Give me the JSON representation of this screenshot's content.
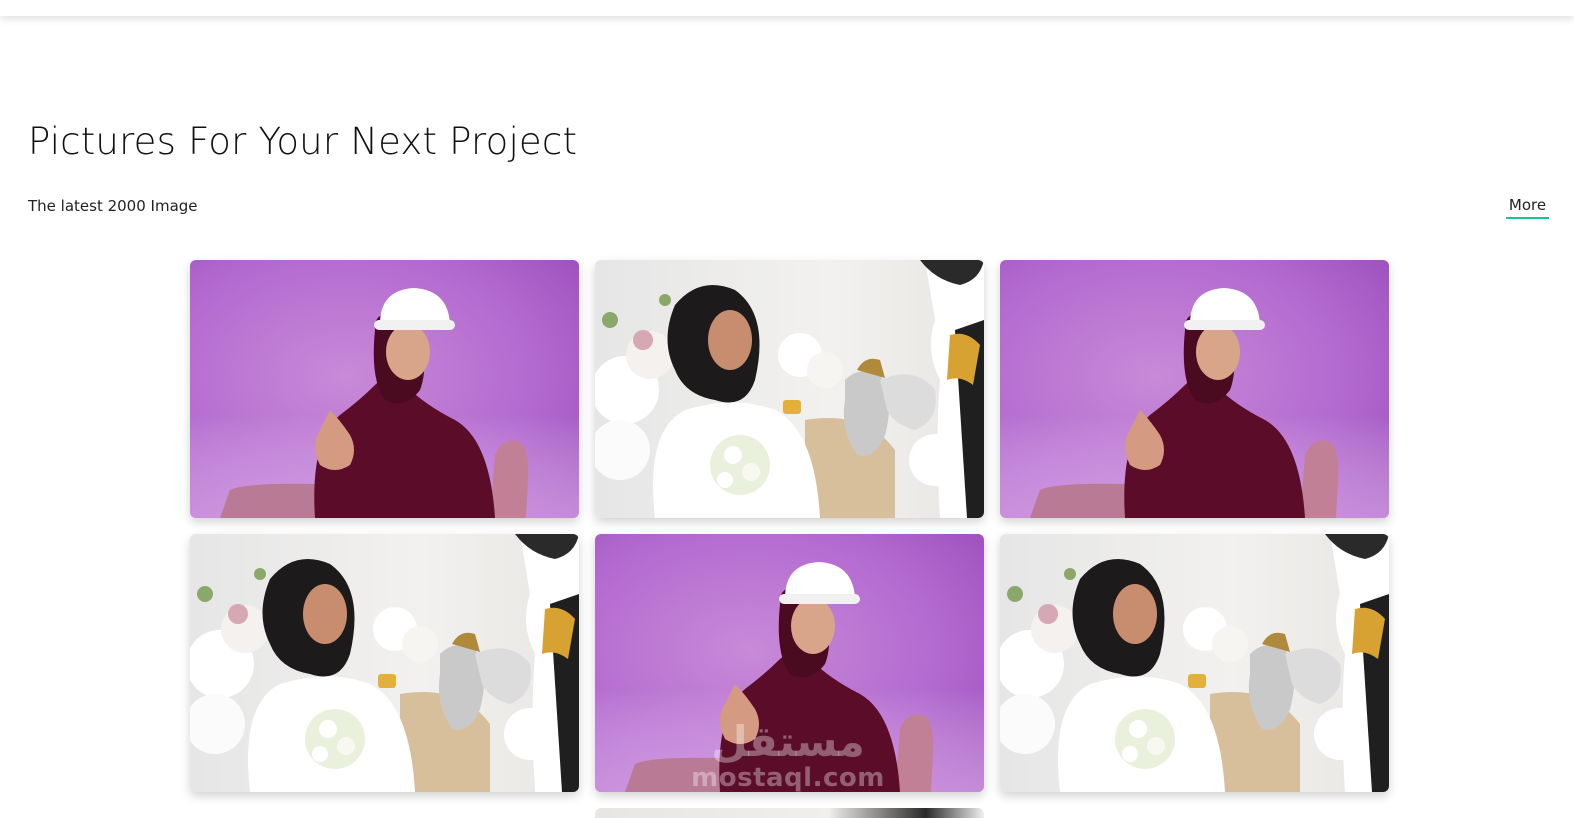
{
  "header": {
    "title": "Pictures For Your Next Project",
    "subtitle": "The latest 2000 Image",
    "more_label": "More"
  },
  "colors": {
    "accent_underline": "#1cc38e",
    "purple_bg": "#b36ad0",
    "hijab": "#5a0c28"
  },
  "gallery": {
    "items": [
      {
        "kind": "engineer",
        "alt": "engineer"
      },
      {
        "kind": "wedding",
        "alt": "wedding"
      },
      {
        "kind": "engineer",
        "alt": "engineer"
      },
      {
        "kind": "wedding",
        "alt": "wedding"
      },
      {
        "kind": "engineer",
        "alt": "engineer"
      },
      {
        "kind": "wedding",
        "alt": "wedding"
      }
    ]
  },
  "watermark": {
    "arabic": "مستقل",
    "latin": "mostaql.com"
  }
}
